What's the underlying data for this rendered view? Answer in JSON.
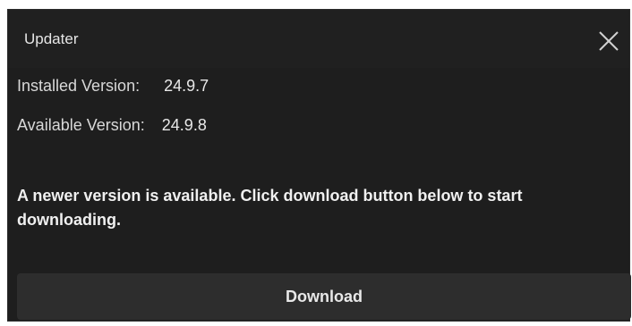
{
  "window": {
    "title": "Updater"
  },
  "versions": {
    "installed_label": "Installed Version:",
    "installed_value": "24.9.7",
    "available_label": "Available Version:",
    "available_value": "24.9.8"
  },
  "message": "A newer version is available. Click download button below to start downloading.",
  "actions": {
    "download_label": "Download"
  },
  "icons": {
    "close": "close-icon"
  },
  "colors": {
    "background": "#1e1e1e",
    "titlebar": "#202020",
    "button": "#2d2d2d",
    "text": "#e8e8e8"
  }
}
